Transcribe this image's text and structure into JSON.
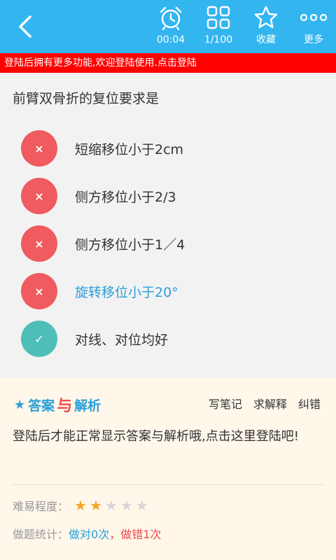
{
  "topbar": {
    "back_icon": "chevron-left-icon",
    "tools": [
      {
        "icon": "alarm-clock-icon",
        "label": "00:04"
      },
      {
        "icon": "grid-icon",
        "label": "1/100"
      },
      {
        "icon": "star-outline-icon",
        "label": "收藏"
      },
      {
        "icon": "more-dots-icon",
        "label": "更多"
      }
    ],
    "color": "#33b5f0"
  },
  "banner": {
    "text": "登陆后拥有更多功能,欢迎登陆使用.点击登陆",
    "color": "#ff0000"
  },
  "question": {
    "title": "前臂双骨折的复位要求是",
    "options": [
      {
        "mark": "×",
        "status": "wrong",
        "text": "短缩移位小于2cm"
      },
      {
        "mark": "×",
        "status": "wrong",
        "text": "侧方移位小于2/3"
      },
      {
        "mark": "×",
        "status": "wrong",
        "text": "侧方移位小于1／4"
      },
      {
        "mark": "×",
        "status": "wrong",
        "text": "旋转移位小于20°"
      },
      {
        "mark": "✓",
        "status": "right",
        "text": "对线、对位均好"
      }
    ]
  },
  "analysis": {
    "logo": {
      "star": "★",
      "part1": "答案",
      "mid": "与",
      "part2": "解析"
    },
    "actions": [
      "写笔记",
      "求解释",
      "纠错"
    ],
    "text": "登陆后才能正常显示答案与解析哦,点击这里登陆吧!",
    "difficulty_label": "难易程度：",
    "difficulty_rating": 2,
    "difficulty_max": 5,
    "stats_label": "做题统计：",
    "stats_right": "做对0次",
    "stats_sep": "，",
    "stats_wrong": "做错1次"
  }
}
